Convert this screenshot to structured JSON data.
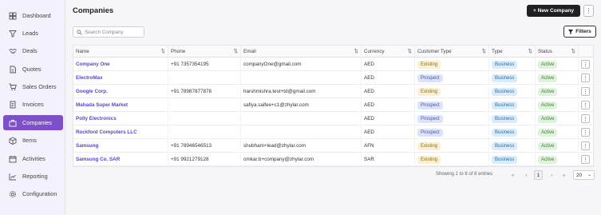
{
  "sidebar": {
    "items": [
      {
        "label": "Dashboard",
        "icon": "dashboard-icon"
      },
      {
        "label": "Leads",
        "icon": "filter-funnel-icon"
      },
      {
        "label": "Deals",
        "icon": "handshake-icon"
      },
      {
        "label": "Quotes",
        "icon": "document-icon"
      },
      {
        "label": "Sales Orders",
        "icon": "cart-icon"
      },
      {
        "label": "Invoices",
        "icon": "invoice-icon"
      },
      {
        "label": "Companies",
        "icon": "building-icon",
        "active": true
      },
      {
        "label": "Items",
        "icon": "box-icon"
      },
      {
        "label": "Activities",
        "icon": "calendar-icon"
      },
      {
        "label": "Reporting",
        "icon": "chart-icon"
      },
      {
        "label": "Configuration",
        "icon": "gear-icon"
      }
    ]
  },
  "header": {
    "title": "Companies",
    "new_button": "+ New Company",
    "more": "⋮"
  },
  "toolbar": {
    "search_placeholder": "Search Company",
    "filters_label": "Filters"
  },
  "table": {
    "columns": [
      "Name",
      "Phone",
      "Email",
      "Currency",
      "Customer Type",
      "Type",
      "Status"
    ],
    "rows": [
      {
        "name": "Company One",
        "phone": "+91 7357354195",
        "email": "companyOne@gmail.com",
        "currency": "AED",
        "customer_type": "Existing",
        "type": "Business",
        "status": "Active"
      },
      {
        "name": "ElectroMax",
        "phone": "",
        "email": "",
        "currency": "AED",
        "customer_type": "Prospect",
        "type": "Business",
        "status": "Active"
      },
      {
        "name": "Google Corp.",
        "phone": "+91 78987877878",
        "email": "harshmishra.test+td@gmail.com",
        "currency": "AED",
        "customer_type": "Existing",
        "type": "Business",
        "status": "Active"
      },
      {
        "name": "Mahada Super Market",
        "phone": "",
        "email": "safiya.saifee+c1@zhylar.com",
        "currency": "AED",
        "customer_type": "Prospect",
        "type": "Business",
        "status": "Active"
      },
      {
        "name": "Polly Electronics",
        "phone": "",
        "email": "",
        "currency": "AED",
        "customer_type": "Prospect",
        "type": "Business",
        "status": "Active"
      },
      {
        "name": "Rockford Computers LLC",
        "phone": "",
        "email": "",
        "currency": "AED",
        "customer_type": "Prospect",
        "type": "Business",
        "status": "Active"
      },
      {
        "name": "Samsung",
        "phone": "+91 78946546513",
        "email": "shubham+lead@zhylar.com",
        "currency": "AFN",
        "customer_type": "Existing",
        "type": "Business",
        "status": "Active"
      },
      {
        "name": "Samsung Co. SAR",
        "phone": "+91 9921279128",
        "email": "omkar.b+company@zhylar.com",
        "currency": "SAR",
        "customer_type": "Existing",
        "type": "Business",
        "status": "Active"
      }
    ]
  },
  "pagination": {
    "info": "Showing 1 to 8 of 8 entries",
    "first": "«",
    "prev": "‹",
    "page": "1",
    "next": "›",
    "last": "»",
    "page_size": "20"
  },
  "colors": {
    "accent": "#7d4fc9",
    "link": "#5b46c6",
    "existing_badge": "#fbf0cf",
    "prospect_badge": "#dde3fb",
    "business_badge": "#d9ecfb",
    "active_badge": "#dff3dc"
  }
}
